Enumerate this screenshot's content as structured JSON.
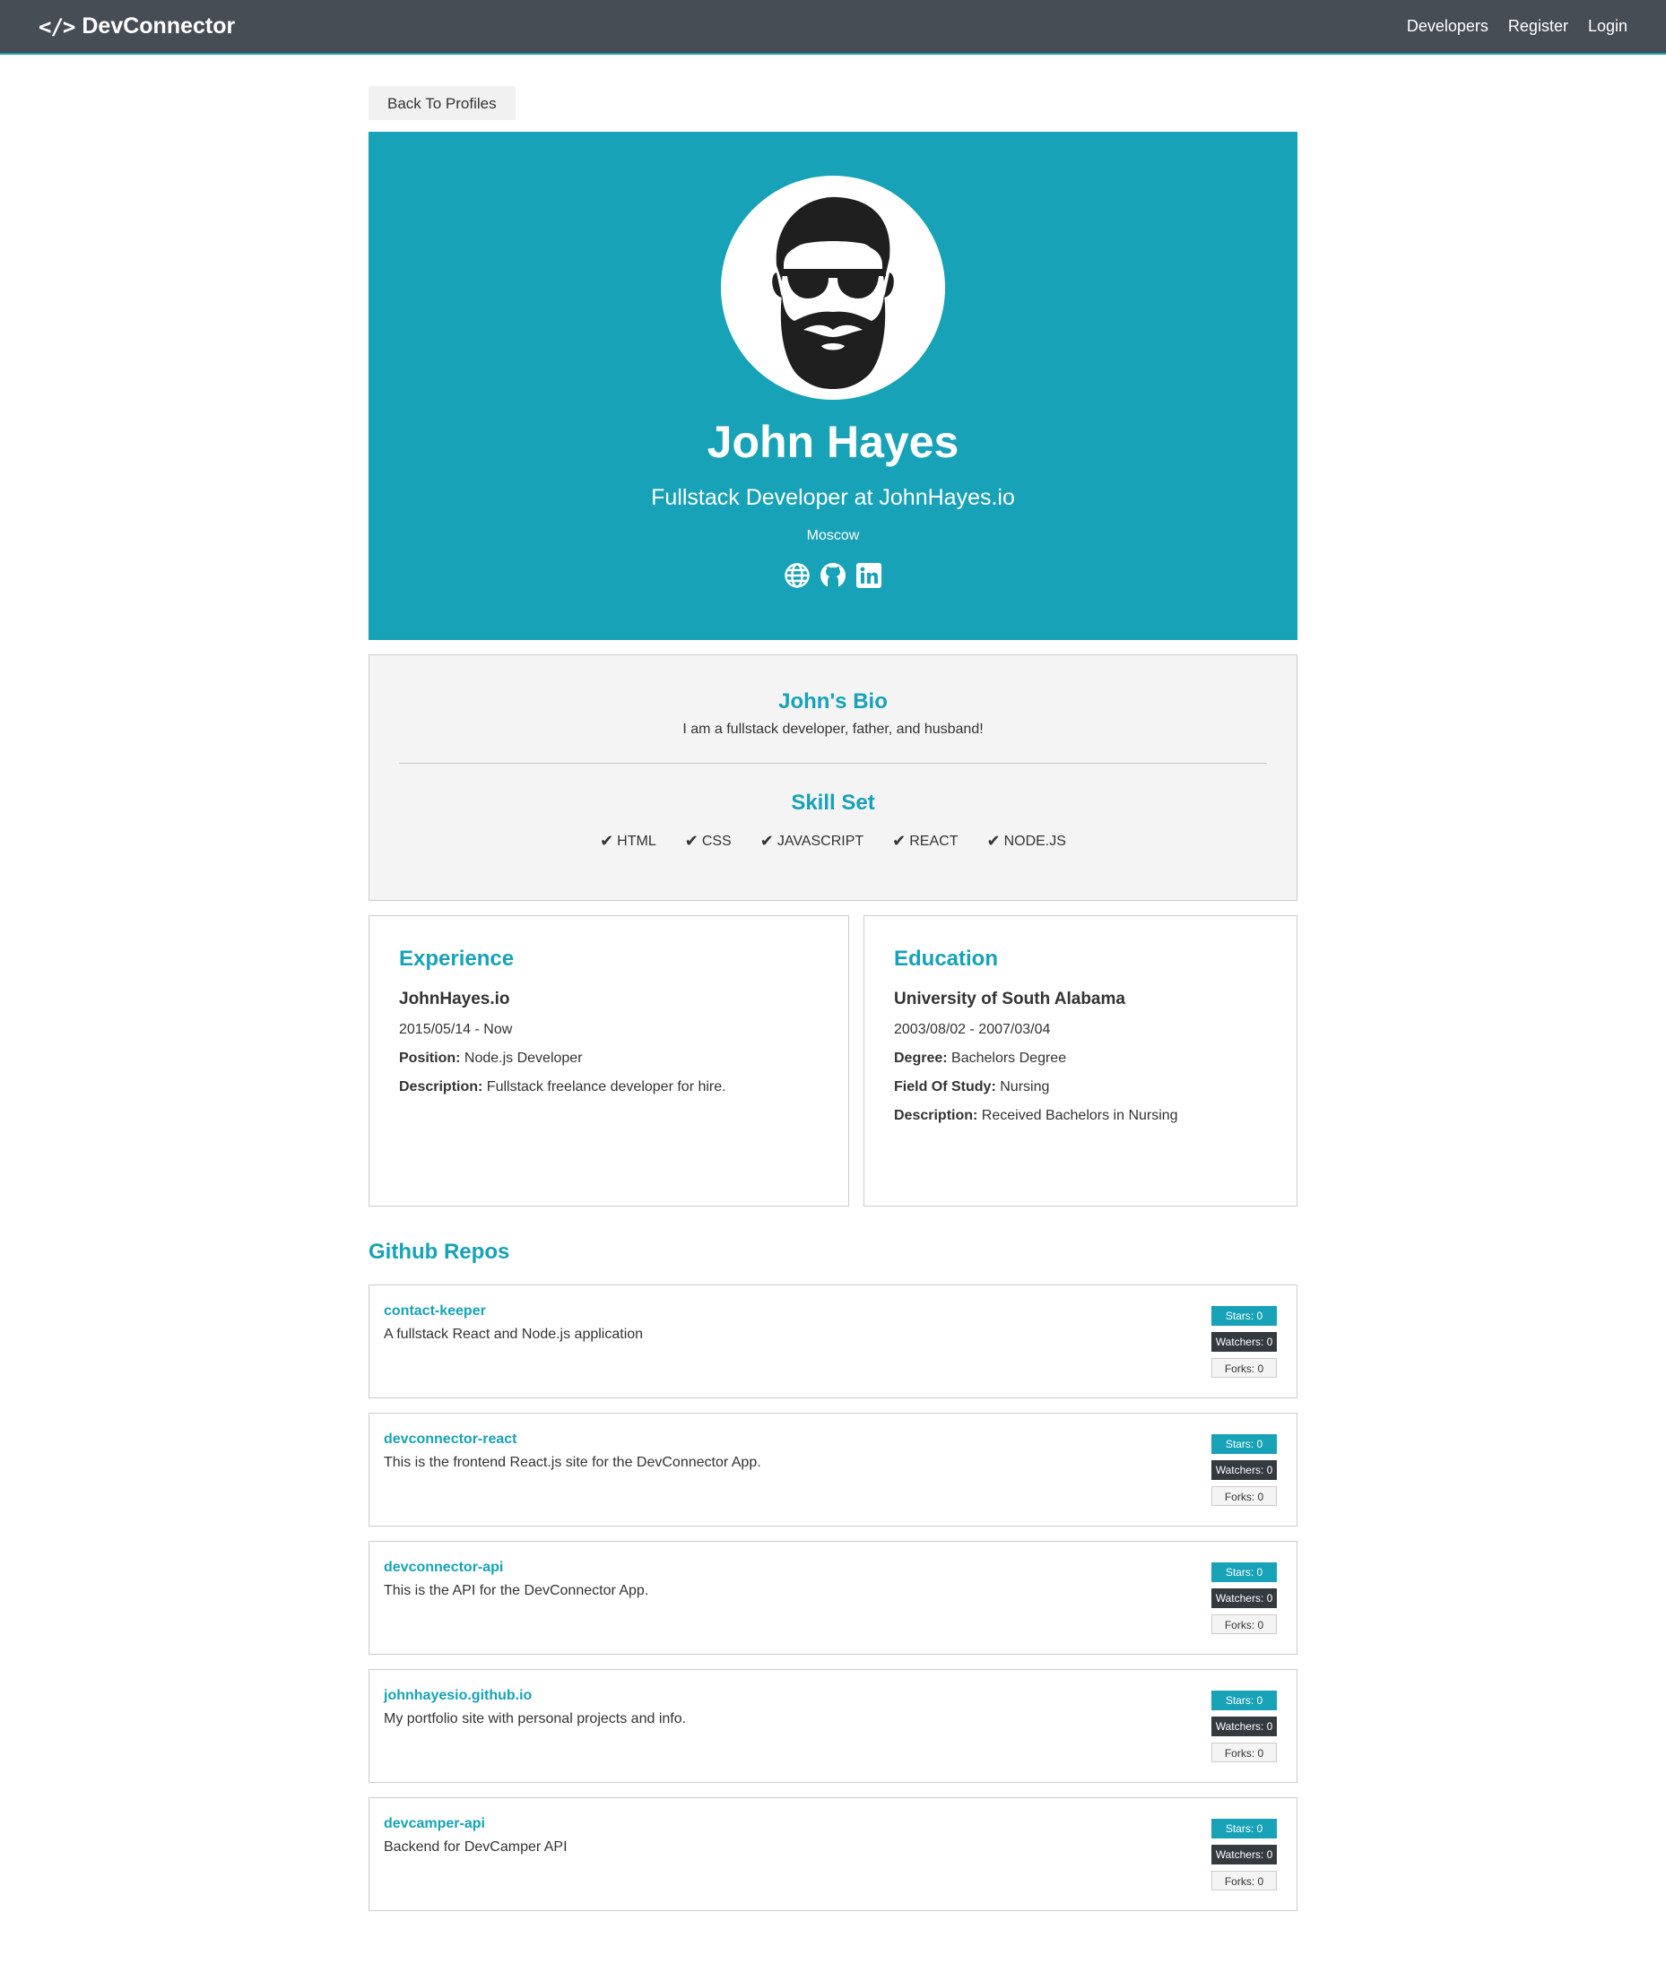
{
  "navbar": {
    "brand_icon": "code-icon",
    "brand": "DevConnector",
    "links": [
      "Developers",
      "Register",
      "Login"
    ]
  },
  "back_button": "Back To Profiles",
  "profile": {
    "avatar_icon": "bearded-man-avatar",
    "name": "John Hayes",
    "status": "Fullstack Developer at JohnHayes.io",
    "location": "Moscow",
    "social_icons": [
      "globe-icon",
      "github-icon",
      "linkedin-icon"
    ]
  },
  "about": {
    "bio_title": "John's Bio",
    "bio": "I am a fullstack developer, father, and husband!",
    "skills_title": "Skill Set",
    "skills": [
      "HTML",
      "CSS",
      "JAVASCRIPT",
      "REACT",
      "NODE.JS"
    ]
  },
  "experience": {
    "title": "Experience",
    "company": "JohnHayes.io",
    "dates": "2015/05/14 - Now",
    "position_label": "Position:",
    "position": "Node.js Developer",
    "description_label": "Description:",
    "description": "Fullstack freelance developer for hire."
  },
  "education": {
    "title": "Education",
    "school": "University of South Alabama",
    "dates": "2003/08/02 - 2007/03/04",
    "degree_label": "Degree:",
    "degree": "Bachelors Degree",
    "field_label": "Field Of Study:",
    "field": "Nursing",
    "description_label": "Description:",
    "description": "Received Bachelors in Nursing"
  },
  "repos": {
    "title": "Github Repos",
    "items": [
      {
        "name": "contact-keeper",
        "description": "A fullstack React and Node.js application",
        "stars": "Stars: 0",
        "watchers": "Watchers: 0",
        "forks": "Forks: 0"
      },
      {
        "name": "devconnector-react",
        "description": "This is the frontend React.js site for the DevConnector App.",
        "stars": "Stars: 0",
        "watchers": "Watchers: 0",
        "forks": "Forks: 0"
      },
      {
        "name": "devconnector-api",
        "description": "This is the API for the DevConnector App.",
        "stars": "Stars: 0",
        "watchers": "Watchers: 0",
        "forks": "Forks: 0"
      },
      {
        "name": "johnhayesio.github.io",
        "description": "My portfolio site with personal projects and info.",
        "stars": "Stars: 0",
        "watchers": "Watchers: 0",
        "forks": "Forks: 0"
      },
      {
        "name": "devcamper-api",
        "description": "Backend for DevCamper API",
        "stars": "Stars: 0",
        "watchers": "Watchers: 0",
        "forks": "Forks: 0"
      }
    ]
  },
  "colors": {
    "primary": "#17a2b8",
    "dark": "#343a40",
    "navbar": "#474d54",
    "light": "#f4f4f4"
  }
}
